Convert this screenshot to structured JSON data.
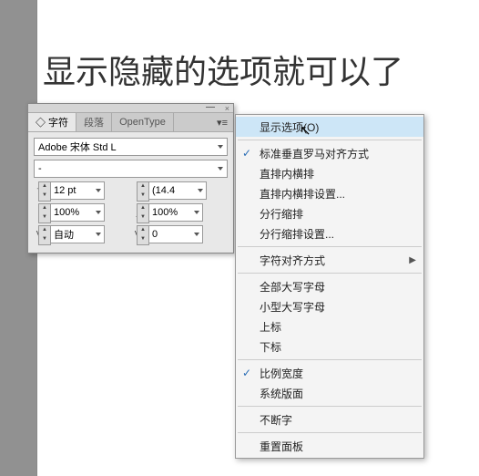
{
  "bigText": "显示隐藏的选项就可以了",
  "tabs": {
    "t1": "◇ 字符",
    "t2": "段落",
    "t3": "OpenType"
  },
  "font": {
    "family": "Adobe 宋体 Std L",
    "style": "-"
  },
  "size": {
    "val": "12 pt",
    "lead": "(14.4"
  },
  "scale": {
    "v": "100%",
    "h": "100%"
  },
  "track": {
    "kern": "自动",
    "val": "0"
  },
  "menu": {
    "m1": "显示选项(O)",
    "m2": "标准垂直罗马对齐方式",
    "m3": "直排内横排",
    "m4": "直排内横排设置...",
    "m5": "分行缩排",
    "m6": "分行缩排设置...",
    "m7": "字符对齐方式",
    "m8": "全部大写字母",
    "m9": "小型大写字母",
    "m10": "上标",
    "m11": "下标",
    "m12": "比例宽度",
    "m13": "系统版面",
    "m14": "不断字",
    "m15": "重置面板"
  }
}
